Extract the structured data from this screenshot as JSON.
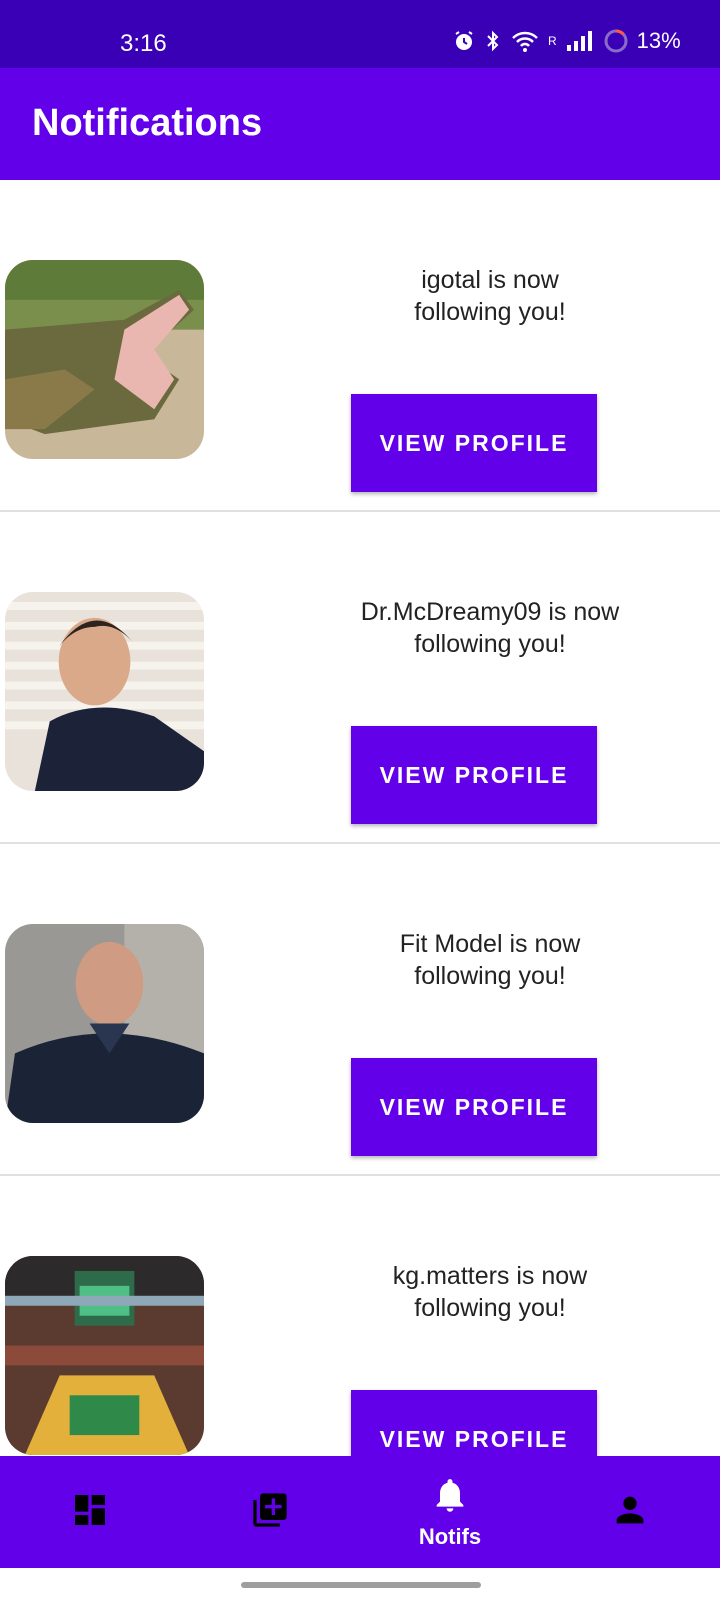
{
  "status_bar": {
    "time": "3:16",
    "battery": "13%",
    "network_label": "R",
    "icons": [
      "alarm-icon",
      "bluetooth-icon",
      "wifi-icon",
      "signal-icon",
      "battery-icon"
    ]
  },
  "app_bar": {
    "title": "Notifications"
  },
  "notifications": [
    {
      "line1": "igotal is now",
      "line2": "following you!",
      "button_label": "VIEW PROFILE",
      "avatar": "crocodile photo"
    },
    {
      "line1": "Dr.McDreamy09 is now",
      "line2": "following you!",
      "button_label": "VIEW PROFILE",
      "avatar": "man in scrubs photo"
    },
    {
      "line1": "Fit Model is now",
      "line2": "following you!",
      "button_label": "VIEW PROFILE",
      "avatar": "man in dark shirt photo"
    },
    {
      "line1": "kg.matters is now",
      "line2": "following you!",
      "button_label": "VIEW PROFILE",
      "avatar": "basketball arena photo"
    }
  ],
  "bottom_nav": {
    "items": [
      {
        "icon": "dashboard-icon",
        "label": ""
      },
      {
        "icon": "add-post-icon",
        "label": ""
      },
      {
        "icon": "bell-icon",
        "label": "Notifs",
        "selected": true
      },
      {
        "icon": "person-icon",
        "label": ""
      }
    ]
  },
  "colors": {
    "primary": "#6200ea",
    "status_bar": "#3a00b6",
    "divider": "#e0e0e0"
  }
}
